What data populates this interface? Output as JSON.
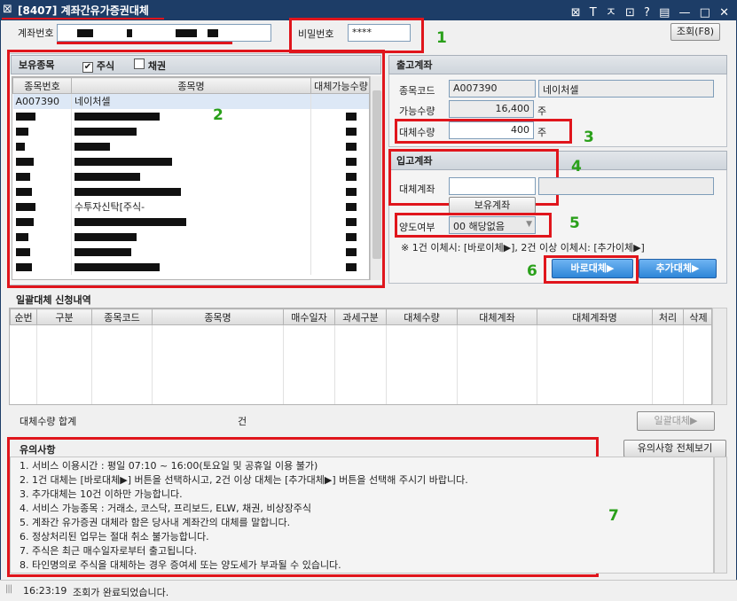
{
  "window": {
    "screen_code": "[8407]",
    "title": "계좌간유가증권대체",
    "icons": [
      "⊠",
      "T",
      "ㅈ",
      "⊡",
      "?",
      "▤",
      "—",
      "□",
      "✕"
    ]
  },
  "account": {
    "account_label": "계좌번호",
    "password_label": "비밀번호",
    "password_value": "****",
    "query_button": "조회(F8)"
  },
  "holdings": {
    "title": "보유종목",
    "stock_checkbox": "주식",
    "stock_checked": true,
    "bond_checkbox": "채권",
    "bond_checked": false,
    "columns": [
      "종목번호",
      "종목명",
      "대체가능수량"
    ],
    "rows": [
      {
        "code": "A007390",
        "name": "네이처셀",
        "qty": ""
      },
      {
        "code": "",
        "name": "",
        "qty": ""
      },
      {
        "code": "",
        "name": "",
        "qty": ""
      },
      {
        "code": "",
        "name": "",
        "qty": ""
      },
      {
        "code": "",
        "name": "",
        "qty": ""
      },
      {
        "code": "",
        "name": "",
        "qty": ""
      },
      {
        "code": "",
        "name": "",
        "qty": ""
      },
      {
        "code": "",
        "name": "수투자신탁[주식-",
        "qty": ""
      },
      {
        "code": "",
        "name": "",
        "qty": ""
      },
      {
        "code": "",
        "name": "",
        "qty": ""
      },
      {
        "code": "",
        "name": "",
        "qty": ""
      },
      {
        "code": "",
        "name": "",
        "qty": ""
      }
    ]
  },
  "outgoing": {
    "title": "출고계좌",
    "code_label": "종목코드",
    "code_value": "A007390",
    "name_value": "네이처셀",
    "avail_label": "가능수량",
    "avail_value": "16,400",
    "unit": "주",
    "transfer_label": "대체수량",
    "transfer_value": "400",
    "transfer_unit": "주"
  },
  "incoming": {
    "title": "입고계좌",
    "account_label": "대체계좌",
    "account_value": "",
    "held_account_button": "보유계좌",
    "transfer_type_label": "양도여부",
    "transfer_type_value": "00 해당없음",
    "note": "※ 1건 이체시: [바로이체▶], 2건 이상 이체시: [추가이체▶]",
    "direct_button": "바로대체▶",
    "add_button": "추가대체▶"
  },
  "batch": {
    "title": "일괄대체 신청내역",
    "columns": [
      "순번",
      "구분",
      "종목코드",
      "종목명",
      "매수일자",
      "과세구분",
      "대체수량",
      "대체계좌",
      "대체계좌명",
      "처리",
      "삭제"
    ],
    "total_label": "대체수량 합계",
    "total_unit": "건",
    "batch_button": "일괄대체▶"
  },
  "notes": {
    "title": "유의사항",
    "view_all_button": "유의사항 전체보기",
    "lines": [
      "1. 서비스 이용시간 : 평일 07:10 ~ 16:00(토요일 및 공휴일 이용 불가)",
      "2. 1건 대체는 [바로대체▶] 버튼을 선택하시고, 2건 이상 대체는 [추가대체▶] 버튼을 선택해 주시기 바랍니다.",
      "3. 추가대체는 10건 이하만 가능합니다.",
      "4. 서비스 가능종목 : 거래소, 코스닥, 프리보드, ELW, 채권, 비상장주식",
      "5. 계좌간 유가증권 대체라 함은 당사내 계좌간의 대체를 말합니다.",
      "6. 정상처리된 업무는 절대 취소 불가능합니다.",
      "7. 주식은 최근 매수일자로부터 출고됩니다.",
      "8. 타인명의로 주식을 대체하는 경우 증여세 또는 양도세가 부과될 수 있습니다."
    ]
  },
  "status": {
    "time": "16:23:19",
    "message": "조회가 완료되었습니다."
  },
  "annotations": [
    "1",
    "2",
    "3",
    "4",
    "5",
    "6",
    "7"
  ],
  "colors": {
    "titlebar": "#1d3d67",
    "highlight": "#e0151c",
    "annotation": "#2aa01a",
    "primary_button": "#2e86d8"
  }
}
